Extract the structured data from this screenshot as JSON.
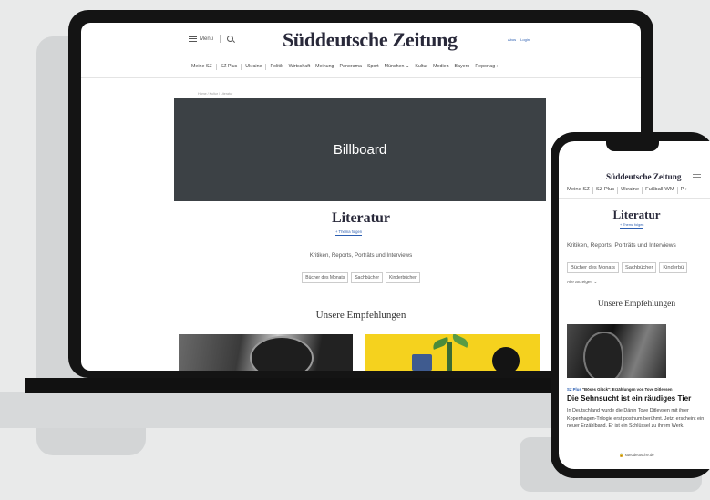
{
  "brand": "Süddeutsche Zeitung",
  "laptop": {
    "menu_label": "Menü",
    "account": [
      "Abos",
      "Login"
    ],
    "nav": [
      "Meine SZ",
      "SZ Plus",
      "Ukraine",
      "Politik",
      "Wirtschaft",
      "Meinung",
      "Panorama",
      "Sport",
      "München ⌄",
      "Kultur",
      "Medien",
      "Bayern",
      "Reportag ›"
    ],
    "breadcrumb": "Home  /  Kultur  /  Literatur",
    "billboard": "Billboard",
    "title": "Literatur",
    "follow": "+ Thema folgen",
    "subtitle": "Kritiken, Reports, Porträts und Interviews",
    "chips": [
      "Bücher des Monats",
      "Sachbücher",
      "Kinderbücher"
    ],
    "recommendations": "Unsere Empfehlungen"
  },
  "phone": {
    "nav": [
      "Meine SZ",
      "SZ Plus",
      "Ukraine",
      "Fußball-WM",
      "P ›"
    ],
    "title": "Literatur",
    "follow": "+ Thema folgen",
    "subtitle": "Kritiken, Reports, Porträts und Interviews",
    "chips": [
      "Bücher des Monats",
      "Sachbücher",
      "Kinderbü"
    ],
    "show_all": "Alle anzeigen ⌄",
    "recommendations": "Unsere Empfehlungen",
    "article": {
      "plus_badge": "SZ Plus",
      "kicker": "\"Böses Glück\": Erzählungen von Tove Ditlevsen",
      "headline": "Die Sehnsucht ist ein räudiges Tier",
      "teaser": "In Deutschland wurde die Dänin Tove Ditlevsen mit ihrer Kopenhagen-Trilogie erst posthum berühmt. Jetzt erscheint ein neuer Erzählband. Er ist ein Schlüssel zu ihrem Werk."
    },
    "url": "🔒 sueddeutsche.de"
  },
  "colors": {
    "link": "#2a5db0",
    "billboard": "#3c4145",
    "device": "#141414",
    "background": "#e9eaea"
  }
}
